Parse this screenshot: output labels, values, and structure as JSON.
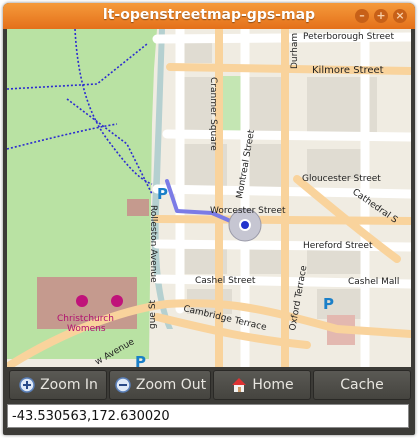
{
  "window": {
    "title": "lt-openstreetmap-gps-map"
  },
  "map": {
    "street_labels": {
      "peterborough": "Peterborough Street",
      "kilmore": "Kilmore Street",
      "durham": "Durham",
      "cranmer": "Cranmer Square",
      "montreal": "Montreal Street",
      "gloucester": "Gloucester Street",
      "cathedral": "Cathedral S",
      "worcester": "Worcester Street",
      "rolleston": "Rolleston Avenue",
      "hereford": "Hereford Street",
      "cashel": "Cashel Street",
      "cashel_mall": "Cashel Mall",
      "oxford": "Oxford Terrace",
      "cambridge": "Cambridge Terrace",
      "hospital1": "Christchurch",
      "hospital2": "Womens",
      "avenue": "w Avenue",
      "st": "gue St"
    },
    "parking_glyph": "P"
  },
  "toolbar": {
    "zoom_in_label": "Zoom In",
    "zoom_out_label": "Zoom Out",
    "home_label": "Home",
    "cache_label": "Cache"
  },
  "status": {
    "coordinates": "-43.530563,172.630020"
  },
  "colors": {
    "titlebar": "#e8761f",
    "park": "#b9e2a3",
    "road_major": "#f9d39c",
    "track": "#7b7be6",
    "path": "#2b2bd0"
  }
}
